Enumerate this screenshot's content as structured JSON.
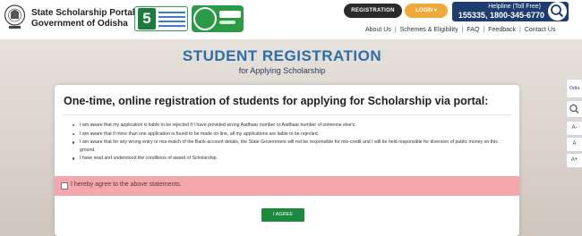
{
  "header": {
    "portal_name": "State Scholarship Portal",
    "government": "Government of Odisha",
    "register_label": "REGISTRATION",
    "login_label": "LOGIN ▾",
    "helpline_label": "Helpline (Toll Free)",
    "helpline_numbers": "155335, 1800-345-6770"
  },
  "nav": {
    "items": [
      "About Us",
      "Schemes & Eligibility",
      "FAQ",
      "Feedback",
      "Contact Us"
    ],
    "separator": "|"
  },
  "hero": {
    "title": "STUDENT REGISTRATION",
    "subtitle": "for Applying Scholarship"
  },
  "card": {
    "title": "One-time, online registration of students for applying for Scholarship via portal:",
    "rules": [
      "I am aware that my application is liable to be rejected if I have provided wrong Aadhaar number or Aadhaar number of someone else's.",
      "I am aware that if more than one application is found to be made on-line, all my applications are liable to be rejected.",
      "I am aware that for any wrong entry or mis-match of the Bank-account details, the State Government will not be responsible for mis-credit and I will be held responsible for diversion of public money on this ground.",
      "I have read and understood the conditions of award of Scholarship."
    ],
    "agree_text": "I hereby agree to the above statements.",
    "agree_checked": false,
    "button_label": "I AGREE"
  },
  "accessibility": {
    "lang_label": "Odia",
    "font_decrease": "A-",
    "font_normal": "A",
    "font_increase": "A+"
  },
  "colors": {
    "header_bg": "#ffffff",
    "title_blue": "#2d6ea6",
    "helpline_bg": "#1f3c6f",
    "login_orange": "#f2a93b",
    "agree_bg": "#f2a8ad",
    "agree_button": "#1b8a3e"
  },
  "icons": {
    "emblem": "odisha-emblem-icon",
    "mission_logo": "5t-logo-icon",
    "mo_sarkar": "mo-sarkar-logo-icon",
    "helpline_search": "search-icon",
    "side_search": "search-icon"
  }
}
